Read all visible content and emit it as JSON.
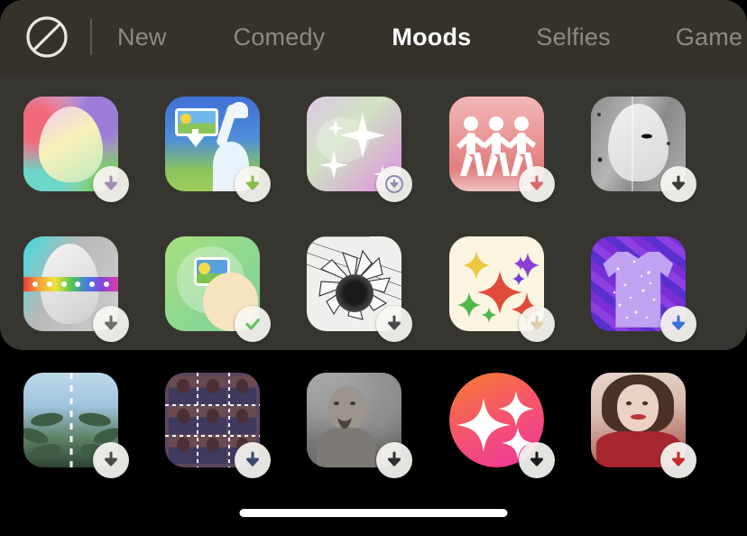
{
  "header": {
    "block_icon": "prohibition-icon",
    "tabs": [
      {
        "label": "New",
        "active": false
      },
      {
        "label": "Comedy",
        "active": false
      },
      {
        "label": "Moods",
        "active": true
      },
      {
        "label": "Selfies",
        "active": false
      },
      {
        "label": "Game",
        "active": false
      }
    ]
  },
  "colors": {
    "panel_bg": "#37352f",
    "header_bg": "#343229",
    "screen_bg": "#000000",
    "tab_inactive": "#8d8b85",
    "tab_active": "#ffffff",
    "badge_bg": "#f8f6f2"
  },
  "grid": {
    "rows": [
      {
        "items": [
          {
            "name": "effect-gradient-portrait",
            "badge": "download-icon",
            "badge_color": "#a78bb5"
          },
          {
            "name": "effect-photo-hand",
            "badge": "download-icon",
            "badge_color": "#7fbf4a"
          },
          {
            "name": "effect-sparkle-glow",
            "badge": "download-icon",
            "badge_color": "#8a8fb5"
          },
          {
            "name": "effect-running-figures",
            "badge": "download-icon",
            "badge_color": "#d96a6a"
          },
          {
            "name": "effect-grayscale-mask",
            "badge": "download-icon",
            "badge_color": "#3a3a3a"
          }
        ]
      },
      {
        "items": [
          {
            "name": "effect-color-slider-face",
            "badge": "download-icon",
            "badge_color": "#6e6e6e"
          },
          {
            "name": "effect-green-photo-blob",
            "badge": "check-icon",
            "badge_color": "#5fbf5f"
          },
          {
            "name": "effect-pencil-sunflower",
            "badge": "download-icon",
            "badge_color": "#4a4a4a"
          },
          {
            "name": "effect-color-sparkles",
            "badge": "download-icon",
            "badge_color": "#cfc9a8"
          },
          {
            "name": "effect-sparkle-tshirt",
            "badge": "download-icon",
            "badge_color": "#3f6fd8"
          }
        ]
      },
      {
        "items": [
          {
            "name": "effect-mirror-nature",
            "badge": "download-icon",
            "badge_color": "#4a4a4a"
          },
          {
            "name": "effect-grid-collage",
            "badge": "download-icon",
            "badge_color": "#3a4a6a"
          },
          {
            "name": "effect-smoky-portrait",
            "badge": "download-icon",
            "badge_color": "#2f2f2f"
          },
          {
            "name": "effect-gradient-sparkle",
            "badge": "download-icon",
            "badge_color": "#ef3580"
          },
          {
            "name": "effect-beauty-portrait",
            "badge": "download-icon",
            "badge_color": "#c02a2a"
          }
        ]
      }
    ]
  },
  "bottom": {
    "home_indicator": "home-indicator"
  }
}
